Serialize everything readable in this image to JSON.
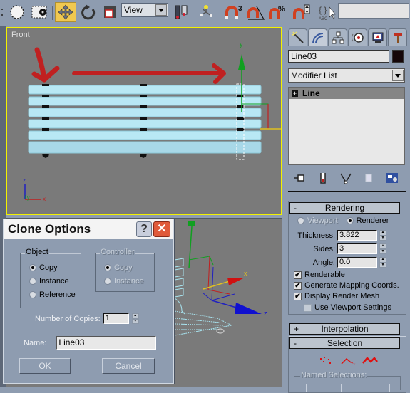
{
  "toolbar": {
    "view_dropdown": "View",
    "icons": [
      "select-circle-icon",
      "select-region-icon",
      "move-icon",
      "rotate-icon",
      "scale-icon",
      "view-dropdown",
      "pivot-center-icon",
      "select-manipulate-icon",
      "snap-3-icon",
      "angle-snap-icon",
      "percent-snap-icon",
      "spinner-snap-icon",
      "edit-named-selection-icon"
    ],
    "snap_label": "3",
    "percent_label": "%",
    "named_selection_value": ""
  },
  "viewports": {
    "front": {
      "label": "Front",
      "axis_labels": {
        "z": "z",
        "y": "y",
        "x": "x",
        "gizmo_y": "y"
      }
    },
    "perspective": {
      "axis_labels": {
        "x": "x",
        "z": "z"
      }
    }
  },
  "command_panel": {
    "tabs": [
      "create-tab",
      "modify-tab",
      "hierarchy-tab",
      "motion-tab",
      "display-tab",
      "utilities-tab"
    ],
    "object_name": "Line03",
    "object_color": "#150608",
    "modifier_list": "Modifier List",
    "stack": [
      {
        "label": "Line",
        "expander": "+"
      }
    ],
    "rendering": {
      "title": "Rendering",
      "sign": "-",
      "viewport_label": "Viewport",
      "renderer_label": "Renderer",
      "selected": "Renderer",
      "thickness_label": "Thickness:",
      "thickness": "3.822",
      "sides_label": "Sides:",
      "sides": "3",
      "angle_label": "Angle:",
      "angle": "0.0",
      "renderable_label": "Renderable",
      "renderable": true,
      "gen_mapping_label": "Generate Mapping Coords.",
      "gen_mapping": true,
      "display_mesh_label": "Display Render Mesh",
      "display_mesh": true,
      "use_viewport_label": "Use Viewport Settings",
      "use_viewport": false
    },
    "interpolation": {
      "title": "Interpolation",
      "sign": "+"
    },
    "selection": {
      "title": "Selection",
      "sign": "-",
      "named_selections_label": "Named Selections:"
    }
  },
  "dialog": {
    "title": "Clone Options",
    "help": "?",
    "close": "✕",
    "object_group": {
      "legend": "Object",
      "options": [
        "Copy",
        "Instance",
        "Reference"
      ],
      "selected": "Copy"
    },
    "controller_group": {
      "legend": "Controller",
      "options": [
        "Copy",
        "Instance"
      ],
      "selected": "Copy",
      "disabled": true
    },
    "copies_label": "Number of Copies:",
    "copies": "1",
    "name_label": "Name:",
    "name": "Line03",
    "ok": "OK",
    "cancel": "Cancel"
  }
}
